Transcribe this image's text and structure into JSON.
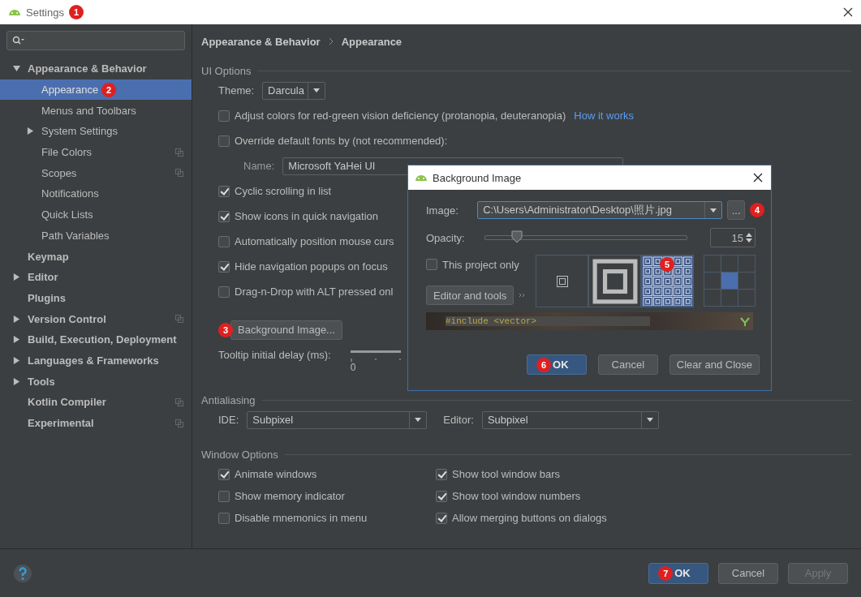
{
  "window": {
    "title": "Settings",
    "badge": "1"
  },
  "sidebar": {
    "items": [
      {
        "label": "Appearance & Behavior",
        "expanded": true,
        "selected": false,
        "children": [
          {
            "label": "Appearance",
            "selected": true,
            "badge": "2"
          },
          {
            "label": "Menus and Toolbars",
            "selected": false
          },
          {
            "label": "System Settings",
            "selected": false,
            "expanded": false
          },
          {
            "label": "File Colors",
            "selected": false,
            "project_level": true
          },
          {
            "label": "Scopes",
            "selected": false,
            "project_level": true
          },
          {
            "label": "Notifications",
            "selected": false
          },
          {
            "label": "Quick Lists",
            "selected": false
          },
          {
            "label": "Path Variables",
            "selected": false
          }
        ]
      },
      {
        "label": "Keymap",
        "selected": false
      },
      {
        "label": "Editor",
        "expanded": false,
        "selected": false
      },
      {
        "label": "Plugins",
        "selected": false
      },
      {
        "label": "Version Control",
        "expanded": false,
        "selected": false,
        "project_level": true
      },
      {
        "label": "Build, Execution, Deployment",
        "expanded": false,
        "selected": false
      },
      {
        "label": "Languages & Frameworks",
        "expanded": false,
        "selected": false
      },
      {
        "label": "Tools",
        "expanded": false,
        "selected": false
      },
      {
        "label": "Kotlin Compiler",
        "selected": false,
        "project_level": true
      },
      {
        "label": "Experimental",
        "selected": false,
        "project_level": true
      }
    ]
  },
  "breadcrumb": [
    "Appearance & Behavior",
    "Appearance"
  ],
  "ui_options": {
    "title": "UI Options",
    "theme": {
      "label": "Theme:",
      "value": "Darcula"
    },
    "adjust_colors": {
      "label": "Adjust colors for red-green vision deficiency (protanopia, deuteranopia)",
      "checked": false,
      "link": "How it works"
    },
    "override_fonts": {
      "label": "Override default fonts by (not recommended):",
      "checked": false
    },
    "font_name": {
      "label": "Name:",
      "value": "Microsoft YaHei UI"
    },
    "checkboxes": [
      {
        "label": "Cyclic scrolling in list",
        "checked": true
      },
      {
        "label": "Show icons in quick navigation",
        "checked": true
      },
      {
        "label": "Automatically position mouse curs",
        "checked": false
      },
      {
        "label": "Hide navigation popups on focus",
        "checked": true
      },
      {
        "label": "Drag-n-Drop with ALT pressed onl",
        "checked": false
      }
    ],
    "background_button": {
      "label": "Background Image...",
      "badge": "3"
    },
    "tooltip_delay": {
      "label": "Tooltip initial delay (ms):",
      "tick_label": "0"
    }
  },
  "antialiasing": {
    "title": "Antialiasing",
    "ide": {
      "label": "IDE:",
      "value": "Subpixel"
    },
    "editor": {
      "label": "Editor:",
      "value": "Subpixel"
    }
  },
  "window_options": {
    "title": "Window Options",
    "checkboxes": [
      {
        "label": "Animate windows",
        "checked": true
      },
      {
        "label": "Show tool window bars",
        "checked": true
      },
      {
        "label": "Show memory indicator",
        "checked": false
      },
      {
        "label": "Show tool window numbers",
        "checked": true
      },
      {
        "label": "Disable mnemonics in menu",
        "checked": false
      },
      {
        "label": "Allow merging buttons on dialogs",
        "checked": true
      }
    ]
  },
  "footer": {
    "buttons": [
      {
        "label": "OK",
        "kind": "primary",
        "badge": "7",
        "disabled": false
      },
      {
        "label": "Cancel",
        "kind": "normal",
        "disabled": false
      },
      {
        "label": "Apply",
        "kind": "normal",
        "disabled": true
      }
    ]
  },
  "dialog": {
    "title": "Background Image",
    "image": {
      "label": "Image:",
      "value": "C:\\Users\\Administrator\\Desktop\\照片.jpg",
      "browse": "...",
      "badge": "4"
    },
    "opacity": {
      "label": "Opacity:",
      "level": 0.15,
      "value": "15"
    },
    "this_project_only": {
      "label": "This project only",
      "checked": false
    },
    "target_button": "Editor and tools",
    "fill_modes": [
      {
        "kind": "center",
        "selected": false
      },
      {
        "kind": "scale",
        "selected": false
      },
      {
        "kind": "tile",
        "selected": true,
        "badge": "5"
      }
    ],
    "anchor": [
      {
        "selected": false
      },
      {
        "selected": false
      },
      {
        "selected": false
      },
      {
        "selected": false
      },
      {
        "selected": true
      },
      {
        "selected": false
      },
      {
        "selected": false
      },
      {
        "selected": false
      },
      {
        "selected": false
      }
    ],
    "preview_code": "#include <vector>",
    "buttons": [
      {
        "label": "OK",
        "kind": "primary",
        "badge": "6"
      },
      {
        "label": "Cancel",
        "kind": "normal"
      },
      {
        "label": "Clear and Close",
        "kind": "normal"
      }
    ]
  }
}
